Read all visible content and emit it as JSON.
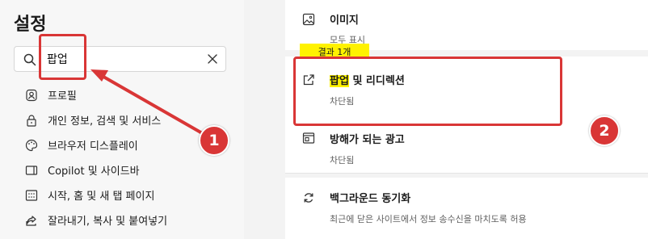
{
  "settings": {
    "title": "설정",
    "search": {
      "value": "팝업",
      "placeholder": ""
    }
  },
  "sidebar": {
    "items": [
      {
        "label": "프로필",
        "icon": "profile-icon"
      },
      {
        "label": "개인 정보, 검색 및 서비스",
        "icon": "lock-icon"
      },
      {
        "label": "브라우저 디스플레이",
        "icon": "palette-icon"
      },
      {
        "label": "Copilot 및 사이드바",
        "icon": "sidebar-icon"
      },
      {
        "label": "시작, 홈 및 새 탭 페이지",
        "icon": "home-grid-icon"
      },
      {
        "label": "잘라내기, 복사 및 붙여넣기",
        "icon": "share-icon"
      }
    ]
  },
  "results": {
    "badge": "결과 1개",
    "images": {
      "title": "이미지",
      "subtitle": "모두 표시",
      "icon": "image-icon"
    },
    "popups": {
      "title_highlight": "팝업",
      "title_rest": " 및 리디렉션",
      "subtitle": "차단됨",
      "icon": "external-link-icon"
    },
    "ads": {
      "title": "방해가 되는 광고",
      "subtitle": "차단됨",
      "icon": "ad-window-icon"
    },
    "sync": {
      "title": "백그라운드 동기화",
      "subtitle": "최근에 닫은 사이트에서 정보 송수신을 마치도록 허용",
      "icon": "sync-icon"
    }
  },
  "annotations": {
    "step1": "1",
    "step2": "2",
    "color": "#d93636"
  },
  "colors": {
    "highlight": "#fff200",
    "accent_red": "#d93636"
  }
}
